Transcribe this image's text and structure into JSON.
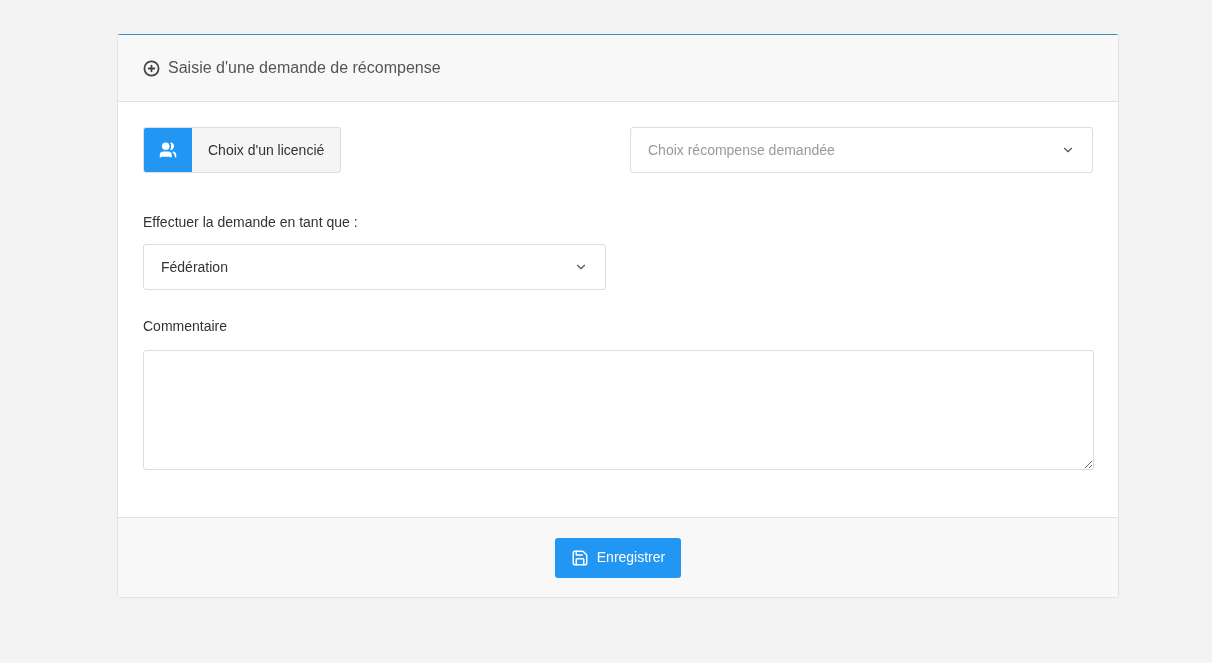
{
  "card": {
    "title": "Saisie d'une demande de récompense"
  },
  "member_button": {
    "label": "Choix d'un licencié"
  },
  "reward_select": {
    "placeholder": "Choix récompense demandée"
  },
  "role": {
    "label": "Effectuer la demande en tant que :",
    "value": "Fédération"
  },
  "comment": {
    "label": "Commentaire"
  },
  "save_button": {
    "label": "Enregistrer"
  }
}
